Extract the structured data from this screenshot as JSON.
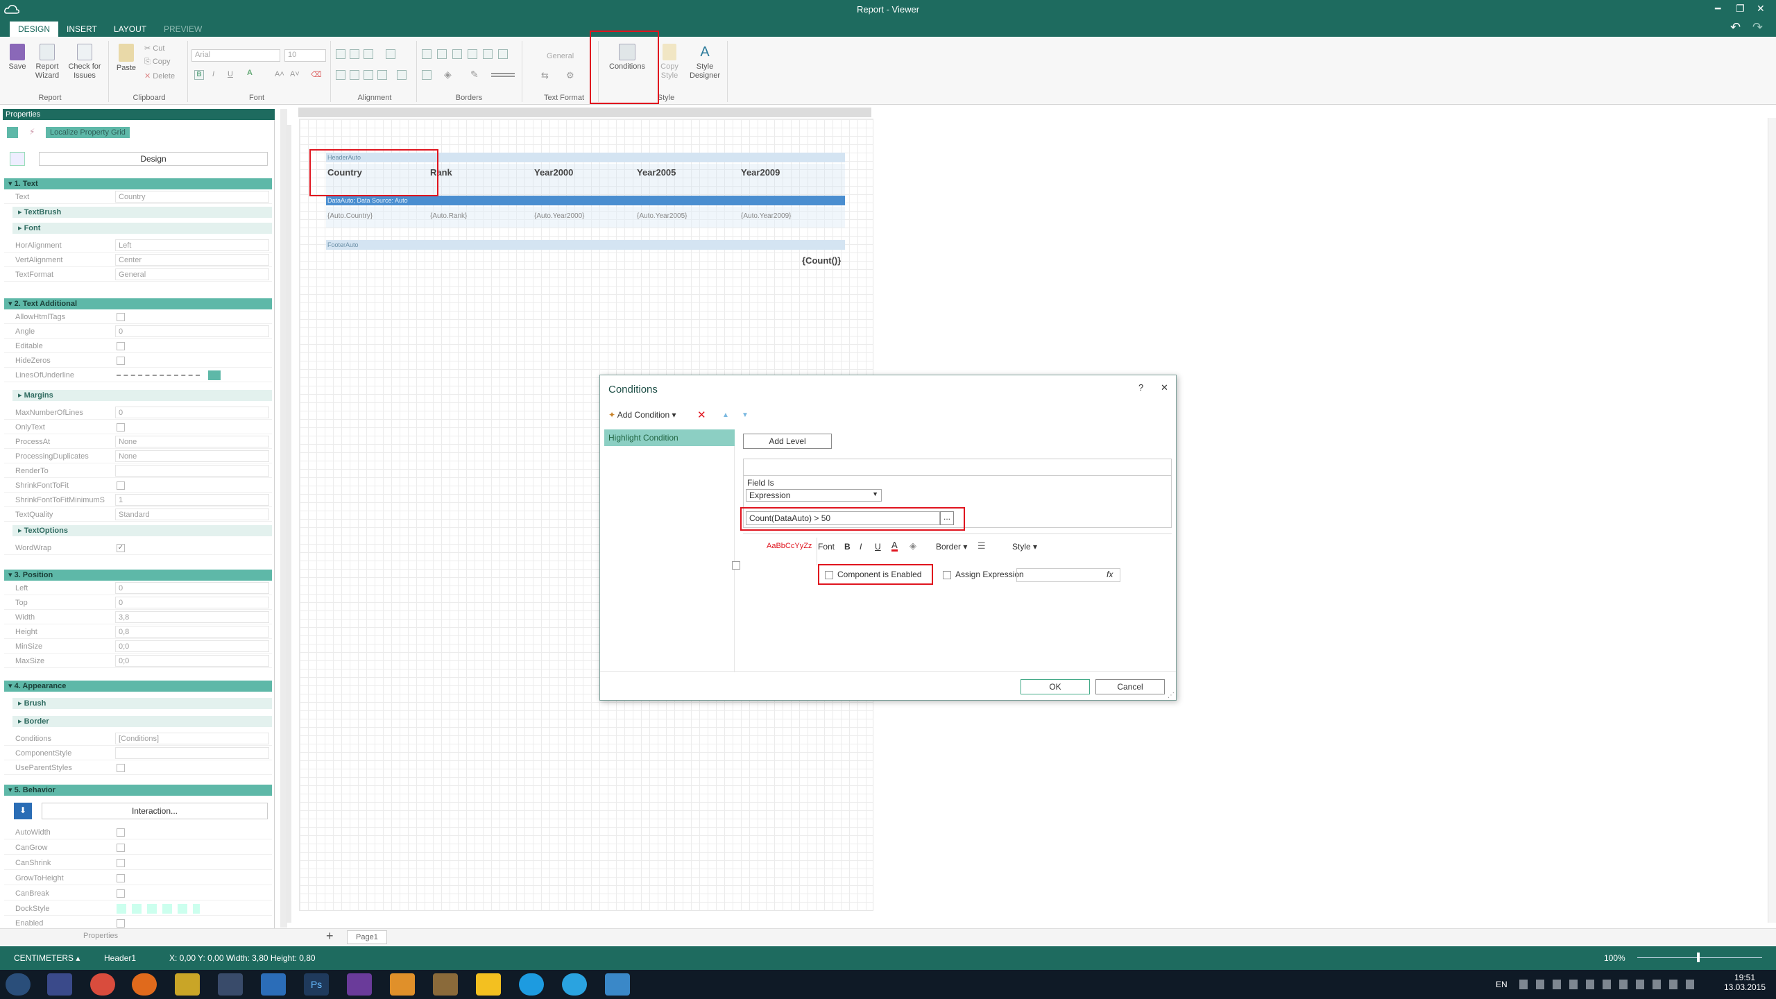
{
  "window": {
    "title": "Report - Viewer"
  },
  "tabs": [
    {
      "label": "DESIGN",
      "state": "active"
    },
    {
      "label": "INSERT",
      "state": "normal"
    },
    {
      "label": "LAYOUT",
      "state": "normal"
    },
    {
      "label": "PREVIEW",
      "state": "disabled"
    }
  ],
  "ribbon": {
    "save": "Save",
    "report_wizard": "Report Wizard",
    "check_issues": "Check for Issues",
    "paste": "Paste",
    "cut": "Cut",
    "copy": "Copy",
    "delete": "Delete",
    "font_name": "Arial",
    "font_size": "10",
    "text_format_value": "General",
    "conditions": "Conditions",
    "copy_style": "Copy Style",
    "style_designer": "Style Designer",
    "groups": {
      "report": "Report",
      "clipboard": "Clipboard",
      "font": "Font",
      "alignment": "Alignment",
      "borders": "Borders",
      "text_format": "Text Format",
      "style": "Style"
    }
  },
  "properties": {
    "title": "Properties",
    "localize": "Localize Property Grid",
    "design_button": "Design",
    "interaction_button": "Interaction...",
    "categories": {
      "text": "1. Text",
      "text_additional": "2. Text Additional",
      "position": "3. Position",
      "appearance": "4. Appearance",
      "behavior": "5. Behavior"
    },
    "subcats": {
      "textbrush": "TextBrush",
      "font": "Font",
      "margins": "Margins",
      "textoptions": "TextOptions",
      "brush": "Brush",
      "border": "Border"
    },
    "rows": {
      "text": {
        "name": "Text",
        "value": "Country"
      },
      "horalignment": {
        "name": "HorAlignment",
        "value": "Left"
      },
      "vertalignment": {
        "name": "VertAlignment",
        "value": "Center"
      },
      "textformat": {
        "name": "TextFormat",
        "value": "General"
      },
      "allowhtmltags": {
        "name": "AllowHtmlTags"
      },
      "angle": {
        "name": "Angle",
        "value": "0"
      },
      "editable": {
        "name": "Editable"
      },
      "hidezeros": {
        "name": "HideZeros"
      },
      "linesofunderline": {
        "name": "LinesOfUnderline"
      },
      "maxnumberoflines": {
        "name": "MaxNumberOfLines",
        "value": "0"
      },
      "onlytext": {
        "name": "OnlyText"
      },
      "processat": {
        "name": "ProcessAt",
        "value": "None"
      },
      "processingduplicates": {
        "name": "ProcessingDuplicates",
        "value": "None"
      },
      "renderto": {
        "name": "RenderTo",
        "value": ""
      },
      "shrinkfonttofit": {
        "name": "ShrinkFontToFit"
      },
      "shrinkfonttofitminimum": {
        "name": "ShrinkFontToFitMinimumS",
        "value": "1"
      },
      "textquality": {
        "name": "TextQuality",
        "value": "Standard"
      },
      "wordwrap": {
        "name": "WordWrap",
        "checked": "✓"
      },
      "left": {
        "name": "Left",
        "value": "0"
      },
      "top": {
        "name": "Top",
        "value": "0"
      },
      "width": {
        "name": "Width",
        "value": "3,8"
      },
      "height": {
        "name": "Height",
        "value": "0,8"
      },
      "minsize": {
        "name": "MinSize",
        "value": "0;0"
      },
      "maxsize": {
        "name": "MaxSize",
        "value": "0;0"
      },
      "conditions": {
        "name": "Conditions",
        "value": "[Conditions]"
      },
      "componentstyle": {
        "name": "ComponentStyle",
        "value": ""
      },
      "useparentstyles": {
        "name": "UseParentStyles"
      },
      "autowidth": {
        "name": "AutoWidth"
      },
      "cangrow": {
        "name": "CanGrow"
      },
      "canshrink": {
        "name": "CanShrink"
      },
      "growtoheight": {
        "name": "GrowToHeight"
      },
      "canbreak": {
        "name": "CanBreak"
      },
      "dockstyle": {
        "name": "DockStyle"
      },
      "enabled": {
        "name": "Enabled"
      }
    },
    "bottom_tab": "Properties"
  },
  "report": {
    "header_band": "HeaderAuto",
    "data_band": "DataAuto; Data Source: Auto",
    "footer_band": "FooterAuto",
    "columns": [
      "Country",
      "Rank",
      "Year2000",
      "Year2005",
      "Year2009"
    ],
    "data_cells": [
      "{Auto.Country}",
      "{Auto.Rank}",
      "{Auto.Year2000}",
      "{Auto.Year2005}",
      "{Auto.Year2009}"
    ],
    "footer_value": "{Count()}",
    "page_tab": "Page1"
  },
  "dialog": {
    "title": "Conditions",
    "help": "?",
    "close": "✕",
    "add_condition": "Add Condition",
    "condition_item": "Highlight Condition",
    "add_level": "Add Level",
    "field_is_label": "Field Is",
    "field_is_value": "Expression",
    "expression": "Count(DataAuto) > 50",
    "ellipsis": "...",
    "font": "Font",
    "bold": "B",
    "italic": "I",
    "underline": "U",
    "border": "Border",
    "style": "Style",
    "sample_text": "AaBbCcYyZz",
    "component_enabled": "Component is Enabled",
    "assign_expression": "Assign Expression",
    "fx": "fx",
    "ok": "OK",
    "cancel": "Cancel"
  },
  "status": {
    "units": "CENTIMETERS",
    "component": "Header1",
    "coords": "X: 0,00  Y: 0,00  Width: 3,80  Height: 0,80",
    "zoom": "100%"
  },
  "taskbar": {
    "lang": "EN",
    "time": "19:51",
    "date": "13.03.2015"
  },
  "colors": {
    "accent": "#1e6b5f",
    "category": "#5eb8a8",
    "highlight": "#e0141e"
  }
}
